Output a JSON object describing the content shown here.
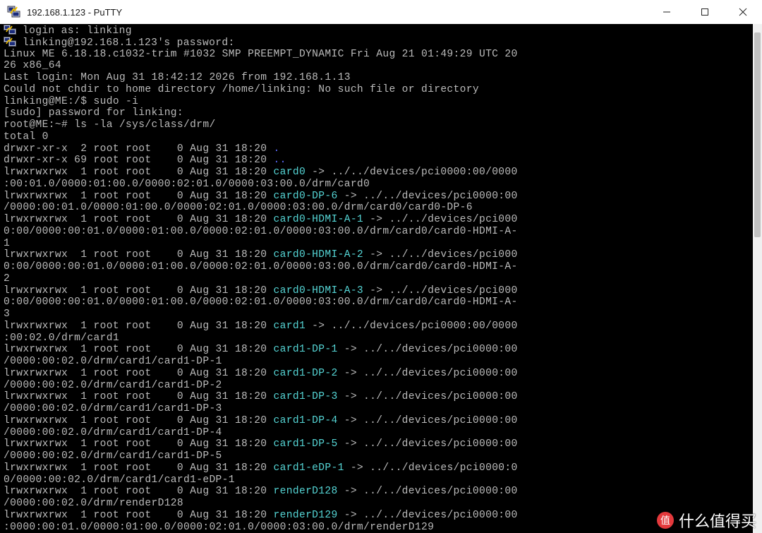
{
  "window": {
    "title": "192.168.1.123 - PuTTY",
    "accent": "#000000"
  },
  "colors": {
    "terminal_bg": "#000000",
    "terminal_fg": "#bbbbbb",
    "symlink": "#55d5d5",
    "directory": "#5c6cff"
  },
  "icons": {
    "app": "putty-icon",
    "login": "putty-key-icon",
    "minimize": "minimize-icon",
    "maximize": "maximize-icon",
    "close": "close-icon"
  },
  "watermark": {
    "text": "什么值得买",
    "icon": "zhide-logo-icon"
  },
  "terminal_lines": [
    {
      "icon": true,
      "segments": [
        {
          "text": "login as: linking"
        }
      ]
    },
    {
      "icon": true,
      "segments": [
        {
          "text": "linking@192.168.1.123's password:"
        }
      ]
    },
    {
      "segments": [
        {
          "text": "Linux ME 6.18.18.c1032-trim #1032 SMP PREEMPT_DYNAMIC Fri Aug 21 01:49:29 UTC 20"
        }
      ]
    },
    {
      "segments": [
        {
          "text": "26 x86_64"
        }
      ]
    },
    {
      "segments": [
        {
          "text": "Last login: Mon Aug 31 18:42:12 2026 from 192.168.1.13"
        }
      ]
    },
    {
      "segments": [
        {
          "text": "Could not chdir to home directory /home/linking: No such file or directory"
        }
      ]
    },
    {
      "segments": [
        {
          "text": "linking@ME:/$ sudo -i"
        }
      ]
    },
    {
      "segments": [
        {
          "text": "[sudo] password for linking:"
        }
      ]
    },
    {
      "segments": [
        {
          "text": "root@ME:~# ls -la /sys/class/drm/"
        }
      ]
    },
    {
      "segments": [
        {
          "text": "total 0"
        }
      ]
    },
    {
      "segments": [
        {
          "text": "drwxr-xr-x  2 root root    0 Aug 31 18:20 "
        },
        {
          "text": ".",
          "cls": "dir"
        }
      ]
    },
    {
      "segments": [
        {
          "text": "drwxr-xr-x 69 root root    0 Aug 31 18:20 "
        },
        {
          "text": "..",
          "cls": "dir"
        }
      ]
    },
    {
      "segments": [
        {
          "text": "lrwxrwxrwx  1 root root    0 Aug 31 18:20 "
        },
        {
          "text": "card0",
          "cls": "link"
        },
        {
          "text": " -> ../../devices/pci0000:00/0000"
        }
      ]
    },
    {
      "segments": [
        {
          "text": ":00:01.0/0000:01:00.0/0000:02:01.0/0000:03:00.0/drm/card0"
        }
      ]
    },
    {
      "segments": [
        {
          "text": "lrwxrwxrwx  1 root root    0 Aug 31 18:20 "
        },
        {
          "text": "card0-DP-6",
          "cls": "link"
        },
        {
          "text": " -> ../../devices/pci0000:00"
        }
      ]
    },
    {
      "segments": [
        {
          "text": "/0000:00:01.0/0000:01:00.0/0000:02:01.0/0000:03:00.0/drm/card0/card0-DP-6"
        }
      ]
    },
    {
      "segments": [
        {
          "text": "lrwxrwxrwx  1 root root    0 Aug 31 18:20 "
        },
        {
          "text": "card0-HDMI-A-1",
          "cls": "link"
        },
        {
          "text": " -> ../../devices/pci000"
        }
      ]
    },
    {
      "segments": [
        {
          "text": "0:00/0000:00:01.0/0000:01:00.0/0000:02:01.0/0000:03:00.0/drm/card0/card0-HDMI-A-"
        }
      ]
    },
    {
      "segments": [
        {
          "text": "1"
        }
      ]
    },
    {
      "segments": [
        {
          "text": "lrwxrwxrwx  1 root root    0 Aug 31 18:20 "
        },
        {
          "text": "card0-HDMI-A-2",
          "cls": "link"
        },
        {
          "text": " -> ../../devices/pci000"
        }
      ]
    },
    {
      "segments": [
        {
          "text": "0:00/0000:00:01.0/0000:01:00.0/0000:02:01.0/0000:03:00.0/drm/card0/card0-HDMI-A-"
        }
      ]
    },
    {
      "segments": [
        {
          "text": "2"
        }
      ]
    },
    {
      "segments": [
        {
          "text": "lrwxrwxrwx  1 root root    0 Aug 31 18:20 "
        },
        {
          "text": "card0-HDMI-A-3",
          "cls": "link"
        },
        {
          "text": " -> ../../devices/pci000"
        }
      ]
    },
    {
      "segments": [
        {
          "text": "0:00/0000:00:01.0/0000:01:00.0/0000:02:01.0/0000:03:00.0/drm/card0/card0-HDMI-A-"
        }
      ]
    },
    {
      "segments": [
        {
          "text": "3"
        }
      ]
    },
    {
      "segments": [
        {
          "text": "lrwxrwxrwx  1 root root    0 Aug 31 18:20 "
        },
        {
          "text": "card1",
          "cls": "link"
        },
        {
          "text": " -> ../../devices/pci0000:00/0000"
        }
      ]
    },
    {
      "segments": [
        {
          "text": ":00:02.0/drm/card1"
        }
      ]
    },
    {
      "segments": [
        {
          "text": "lrwxrwxrwx  1 root root    0 Aug 31 18:20 "
        },
        {
          "text": "card1-DP-1",
          "cls": "link"
        },
        {
          "text": " -> ../../devices/pci0000:00"
        }
      ]
    },
    {
      "segments": [
        {
          "text": "/0000:00:02.0/drm/card1/card1-DP-1"
        }
      ]
    },
    {
      "segments": [
        {
          "text": "lrwxrwxrwx  1 root root    0 Aug 31 18:20 "
        },
        {
          "text": "card1-DP-2",
          "cls": "link"
        },
        {
          "text": " -> ../../devices/pci0000:00"
        }
      ]
    },
    {
      "segments": [
        {
          "text": "/0000:00:02.0/drm/card1/card1-DP-2"
        }
      ]
    },
    {
      "segments": [
        {
          "text": "lrwxrwxrwx  1 root root    0 Aug 31 18:20 "
        },
        {
          "text": "card1-DP-3",
          "cls": "link"
        },
        {
          "text": " -> ../../devices/pci0000:00"
        }
      ]
    },
    {
      "segments": [
        {
          "text": "/0000:00:02.0/drm/card1/card1-DP-3"
        }
      ]
    },
    {
      "segments": [
        {
          "text": "lrwxrwxrwx  1 root root    0 Aug 31 18:20 "
        },
        {
          "text": "card1-DP-4",
          "cls": "link"
        },
        {
          "text": " -> ../../devices/pci0000:00"
        }
      ]
    },
    {
      "segments": [
        {
          "text": "/0000:00:02.0/drm/card1/card1-DP-4"
        }
      ]
    },
    {
      "segments": [
        {
          "text": "lrwxrwxrwx  1 root root    0 Aug 31 18:20 "
        },
        {
          "text": "card1-DP-5",
          "cls": "link"
        },
        {
          "text": " -> ../../devices/pci0000:00"
        }
      ]
    },
    {
      "segments": [
        {
          "text": "/0000:00:02.0/drm/card1/card1-DP-5"
        }
      ]
    },
    {
      "segments": [
        {
          "text": "lrwxrwxrwx  1 root root    0 Aug 31 18:20 "
        },
        {
          "text": "card1-eDP-1",
          "cls": "link"
        },
        {
          "text": " -> ../../devices/pci0000:0"
        }
      ]
    },
    {
      "segments": [
        {
          "text": "0/0000:00:02.0/drm/card1/card1-eDP-1"
        }
      ]
    },
    {
      "segments": [
        {
          "text": "lrwxrwxrwx  1 root root    0 Aug 31 18:20 "
        },
        {
          "text": "renderD128",
          "cls": "link"
        },
        {
          "text": " -> ../../devices/pci0000:00"
        }
      ]
    },
    {
      "segments": [
        {
          "text": "/0000:00:02.0/drm/renderD128"
        }
      ]
    },
    {
      "segments": [
        {
          "text": "lrwxrwxrwx  1 root root    0 Aug 31 18:20 "
        },
        {
          "text": "renderD129",
          "cls": "link"
        },
        {
          "text": " -> ../../devices/pci0000:00"
        }
      ]
    },
    {
      "segments": [
        {
          "text": ":0000:00:01.0/0000:01:00.0/0000:02:01.0/0000:03:00.0/drm/renderD129"
        }
      ]
    }
  ]
}
